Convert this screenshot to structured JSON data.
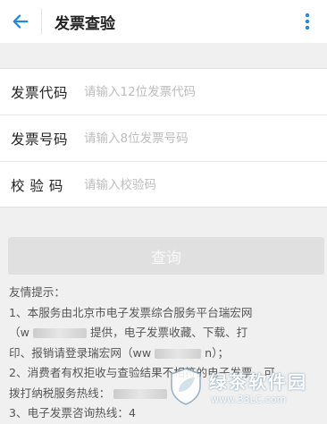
{
  "header": {
    "title": "发票查验",
    "back_icon": "arrow-left-icon",
    "more_icon": "more-vertical-icon",
    "accent": "#1e88e5"
  },
  "form": {
    "fields": [
      {
        "label": "发票代码",
        "placeholder": "请输入12位发票代码"
      },
      {
        "label": "发票号码",
        "placeholder": "请输入8位发票号码"
      },
      {
        "label": "校 验 码",
        "placeholder": "请输入校验码"
      }
    ]
  },
  "query_button": {
    "label": "查询"
  },
  "tips": {
    "title": "友情提示：",
    "line1_a": "1、本服务由北京市电子发票综合服务平台瑞宏网",
    "line1_b_pre": "（w",
    "line1_b_post": "提供，电子发票收藏、下载、打",
    "line1_c_pre": "印、报销请登录瑞宏网（ww",
    "line1_c_post": "n）；",
    "line2_a": "2、消费者有权拒收与查验结果不相符的电子发票，可",
    "line2_b": "拨打纳税服务热线：",
    "line3": "3、电子发票咨询热线：4"
  },
  "watermark": {
    "title": "绿茶软件园",
    "url": "www.33LC.com"
  }
}
